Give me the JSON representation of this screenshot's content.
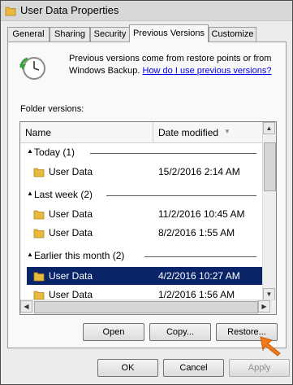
{
  "window": {
    "title": "User Data Properties"
  },
  "tabs": [
    {
      "label": "General"
    },
    {
      "label": "Sharing"
    },
    {
      "label": "Security"
    },
    {
      "label": "Previous Versions"
    },
    {
      "label": "Customize"
    }
  ],
  "active_tab": "Previous Versions",
  "description": {
    "text": "Previous versions come from restore points or from Windows Backup.",
    "link": "How do I use previous versions?"
  },
  "folder_versions_label": "Folder versions:",
  "columns": {
    "name": "Name",
    "date": "Date modified"
  },
  "groups": [
    {
      "label": "Today (1)",
      "rows": [
        {
          "name": "User Data",
          "date": "15/2/2016 2:14 AM"
        }
      ]
    },
    {
      "label": "Last week (2)",
      "rows": [
        {
          "name": "User Data",
          "date": "11/2/2016 10:45 AM"
        },
        {
          "name": "User Data",
          "date": "8/2/2016 1:55 AM"
        }
      ]
    },
    {
      "label": "Earlier this month (2)",
      "rows": [
        {
          "name": "User Data",
          "date": "4/2/2016 10:27 AM",
          "selected": true
        },
        {
          "name": "User Data",
          "date": "1/2/2016 1:56 AM"
        }
      ]
    }
  ],
  "actions": {
    "open": "Open",
    "copy": "Copy...",
    "restore": "Restore..."
  },
  "dialog_buttons": {
    "ok": "OK",
    "cancel": "Cancel",
    "apply": "Apply"
  },
  "colors": {
    "selection": "#0a246a",
    "link": "#0000ee",
    "pointer": "#f07a1e"
  }
}
